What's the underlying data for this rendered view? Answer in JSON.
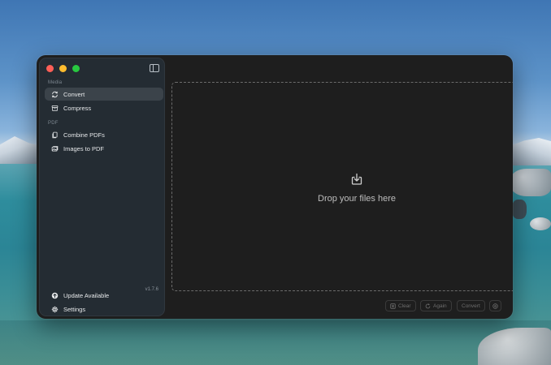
{
  "sidebar": {
    "sections": [
      {
        "label": "Media",
        "items": [
          {
            "label": "Convert",
            "icon": "convert-arrows-icon",
            "active": true
          },
          {
            "label": "Compress",
            "icon": "archive-box-icon",
            "active": false
          }
        ]
      },
      {
        "label": "PDF",
        "items": [
          {
            "label": "Combine PDFs",
            "icon": "documents-icon",
            "active": false
          },
          {
            "label": "Images to PDF",
            "icon": "photos-icon",
            "active": false
          }
        ]
      }
    ],
    "footer": {
      "update_label": "Update Available",
      "version": "v1.7.6",
      "settings_label": "Settings"
    }
  },
  "main": {
    "drop_text": "Drop your files here"
  },
  "toolbar": {
    "clear_label": "Clear",
    "again_label": "Again",
    "convert_label": "Convert"
  },
  "colors": {
    "window_bg": "#1e1e1e",
    "sidebar_bg": "#242c33",
    "active_item_bg": "#3b434a"
  }
}
